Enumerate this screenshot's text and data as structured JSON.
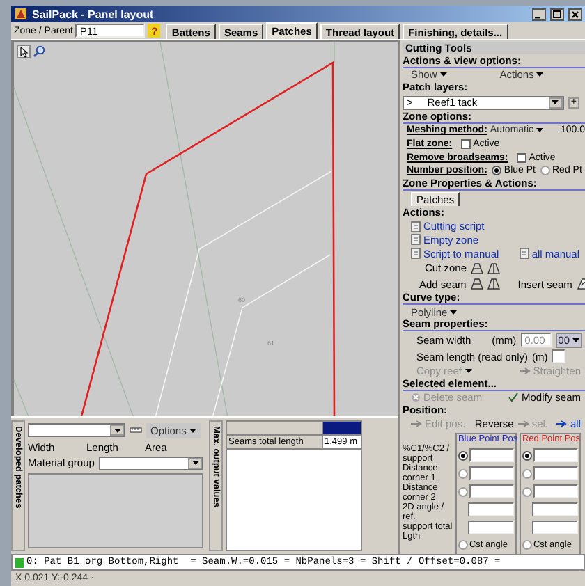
{
  "window": {
    "title": "SailPack - Panel layout"
  },
  "zone_parent": {
    "label": "Zone / Parent",
    "value": "P11",
    "help": "?"
  },
  "tabs": [
    {
      "label": "Battens",
      "selected": false
    },
    {
      "label": "Seams",
      "selected": false
    },
    {
      "label": "Patches",
      "selected": true
    },
    {
      "label": "Thread layout",
      "selected": false
    },
    {
      "label": "Finishing, details...",
      "selected": false
    }
  ],
  "canvas": {
    "labels": [
      "60",
      "61"
    ]
  },
  "cutting_tools": {
    "title": "Cutting Tools",
    "actions_view": {
      "heading": "Actions & view options:",
      "menus": [
        "Show",
        "Actions"
      ]
    },
    "patch_layers": {
      "heading": "Patch layers:",
      "value": ">     Reef1 tack",
      "add": "+"
    },
    "zone_options": {
      "heading": "Zone options:",
      "meshing": {
        "label": "Meshing method:",
        "value": "Automatic",
        "percent": "100.0"
      },
      "flat_zone": {
        "label": "Flat zone:",
        "option": "Active",
        "checked": false
      },
      "remove_broadseams": {
        "label": "Remove broadseams:",
        "option": "Active",
        "checked": false
      },
      "number_position": {
        "label": "Number position:",
        "options": [
          {
            "label": "Blue Pt",
            "selected": true
          },
          {
            "label": "Red Pt",
            "selected": false
          }
        ]
      }
    },
    "zone_properties": {
      "heading": "Zone Properties & Actions:",
      "tabs": [
        {
          "label": "Patches",
          "selected": true
        }
      ],
      "actions_heading": "Actions:",
      "links": [
        {
          "label": "Cutting script"
        },
        {
          "label": "Empty zone"
        },
        {
          "label": "Script to manual"
        },
        {
          "label": "all manual"
        }
      ],
      "cut_zone": "Cut zone",
      "add_seam": "Add seam",
      "insert_seam": "Insert seam",
      "curve_type": {
        "heading": "Curve type:",
        "value": "Polyline"
      },
      "seam_properties": {
        "heading": "Seam properties:",
        "seam_width": {
          "label": "Seam width",
          "unit": "(mm)",
          "value": "0.00",
          "disabled": true,
          "button": "00"
        },
        "seam_length": {
          "label": "Seam length (read only)",
          "unit": "(m)"
        },
        "copy_reef": {
          "label": "Copy reef",
          "disabled": true
        },
        "straighten": {
          "label": "Straighten",
          "disabled": true
        }
      },
      "selected_element": {
        "heading": "Selected element...",
        "buttons": [
          {
            "label": "Delete seam",
            "disabled": true
          },
          {
            "label": "Modify seam",
            "disabled": false
          }
        ]
      },
      "position": {
        "heading": "Position:",
        "edit_pos": {
          "label": "Edit pos.",
          "disabled": true
        },
        "reverse": "Reverse",
        "sel": {
          "label": "sel.",
          "disabled": true
        },
        "all": {
          "label": "all",
          "disabled": false
        }
      },
      "point_rows": [
        "%C1/%C2 / support",
        "Distance corner 1",
        "Distance corner 2",
        "2D angle / ref.",
        "support total Lgth"
      ],
      "groups": [
        {
          "title": "Blue Point Pos",
          "color": "#2020c0",
          "cells": [
            {
              "kind": "radio-input",
              "selected": true
            },
            {
              "kind": "radio-input",
              "selected": false
            },
            {
              "kind": "radio-input",
              "selected": false
            },
            {
              "kind": "input"
            },
            {
              "kind": "input"
            },
            {
              "kind": "radio",
              "label": "Cst angle",
              "selected": false
            }
          ]
        },
        {
          "title": "Red Point Pos",
          "color": "#d02020",
          "cells": [
            {
              "kind": "radio-input",
              "selected": true
            },
            {
              "kind": "radio-input",
              "selected": false
            },
            {
              "kind": "radio-input",
              "selected": false
            },
            {
              "kind": "input"
            },
            {
              "kind": "input"
            },
            {
              "kind": "radio",
              "label": "Cst angle",
              "selected": false
            }
          ]
        }
      ]
    }
  },
  "developed_patches": {
    "title": "Developed patches",
    "options": "Options",
    "columns": [
      "Width",
      "Length",
      "Area"
    ],
    "material_group": "Material group"
  },
  "max_output": {
    "title": "Max. output values",
    "rows": [
      {
        "name": "Seams total length",
        "value": "1.499 m"
      }
    ]
  },
  "status": "0: Pat B1 org Bottom,Right  = Seam.W.=0.015 = NbPanels=3 = Shift / Offset=0.087 =",
  "coordinates": "X 0.021 Y:-0.244 ·"
}
